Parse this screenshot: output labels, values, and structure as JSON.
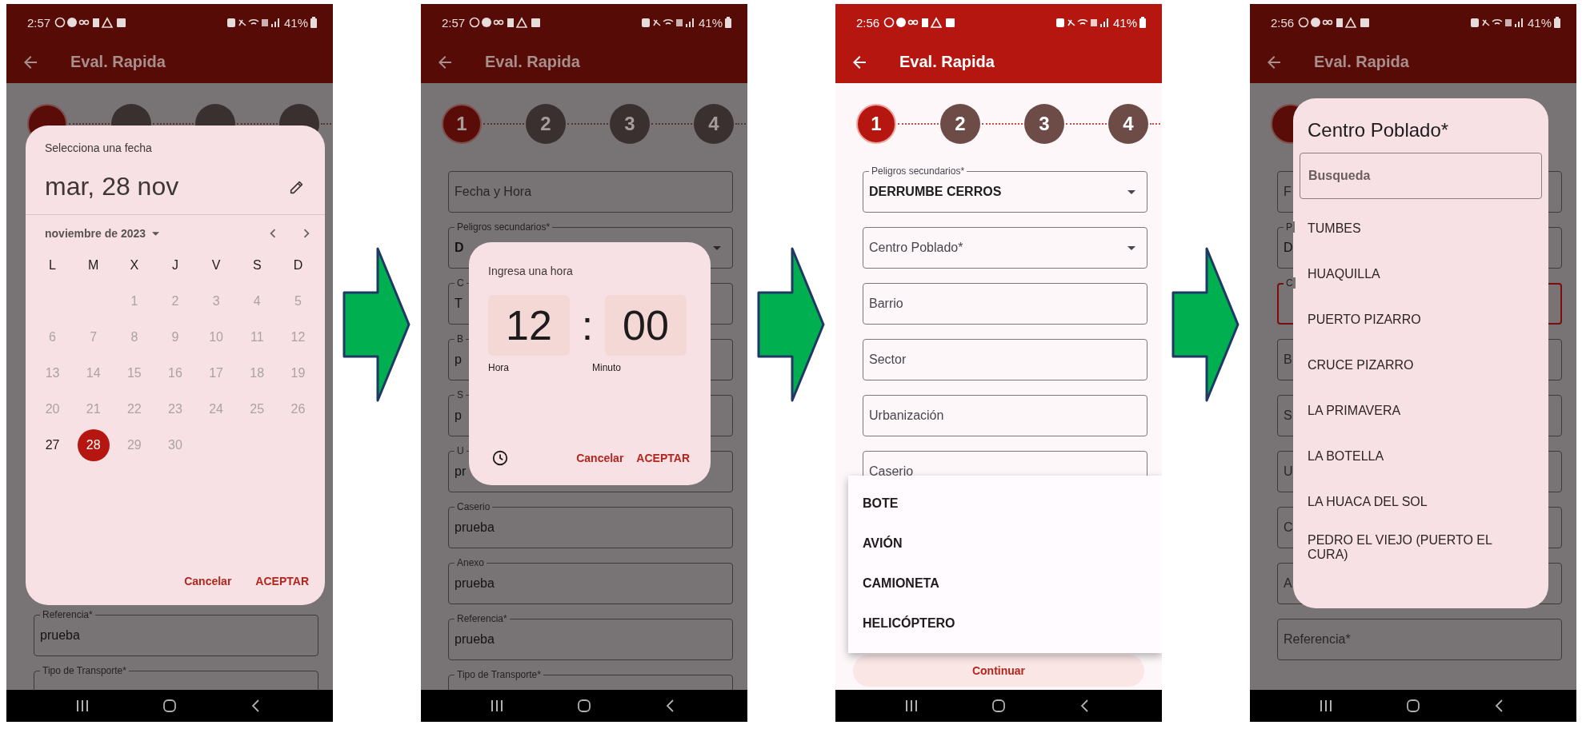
{
  "screens": [
    {
      "status": {
        "time": "2:57",
        "battery": "41%"
      },
      "app_bar": {
        "title": "Eval. Rapida"
      },
      "dimmed": true,
      "steps": [
        {
          "selected": true
        },
        {
          "selected": false
        },
        {
          "selected": false
        },
        {
          "selected": false
        }
      ],
      "fields": [
        {
          "kind": "text",
          "label": "Referencia*",
          "value": "prueba"
        },
        {
          "kind": "dropdown",
          "label": "Tipo de Transporte*"
        }
      ],
      "overlay": {
        "kind": "date_picker",
        "title": "Selecciona una fecha",
        "headline": "mar, 28 nov",
        "month": "noviembre de 2023",
        "weekdays": [
          "L",
          "M",
          "X",
          "J",
          "V",
          "S",
          "D"
        ],
        "weeks": [
          [
            {
              "label": "1",
              "disabled": true,
              "selected": false
            },
            {
              "label": "2",
              "disabled": true,
              "selected": false
            },
            {
              "label": "3",
              "disabled": true,
              "selected": false
            },
            {
              "label": "4",
              "disabled": true,
              "selected": false
            },
            {
              "label": "5",
              "disabled": true,
              "selected": false
            }
          ],
          [
            {
              "label": "6",
              "disabled": true,
              "selected": false
            },
            {
              "label": "7",
              "disabled": true,
              "selected": false
            },
            {
              "label": "8",
              "disabled": true,
              "selected": false
            },
            {
              "label": "9",
              "disabled": true,
              "selected": false
            },
            {
              "label": "10",
              "disabled": true,
              "selected": false
            },
            {
              "label": "11",
              "disabled": true,
              "selected": false
            },
            {
              "label": "12",
              "disabled": true,
              "selected": false
            }
          ],
          [
            {
              "label": "13",
              "disabled": true,
              "selected": false
            },
            {
              "label": "14",
              "disabled": true,
              "selected": false
            },
            {
              "label": "15",
              "disabled": true,
              "selected": false
            },
            {
              "label": "16",
              "disabled": true,
              "selected": false
            },
            {
              "label": "17",
              "disabled": true,
              "selected": false
            },
            {
              "label": "18",
              "disabled": true,
              "selected": false
            },
            {
              "label": "19",
              "disabled": true,
              "selected": false
            }
          ],
          [
            {
              "label": "20",
              "disabled": true,
              "selected": false
            },
            {
              "label": "21",
              "disabled": true,
              "selected": false
            },
            {
              "label": "22",
              "disabled": true,
              "selected": false
            },
            {
              "label": "23",
              "disabled": true,
              "selected": false
            },
            {
              "label": "24",
              "disabled": true,
              "selected": false
            },
            {
              "label": "25",
              "disabled": true,
              "selected": false
            },
            {
              "label": "26",
              "disabled": true,
              "selected": false
            }
          ],
          [
            {
              "label": "27",
              "disabled": false,
              "selected": false
            },
            {
              "label": "28",
              "disabled": false,
              "selected": true
            },
            {
              "label": "29",
              "disabled": true,
              "selected": false
            },
            {
              "label": "30",
              "disabled": true,
              "selected": false
            }
          ]
        ],
        "actions": [
          "Cancelar",
          "ACEPTAR"
        ]
      }
    },
    {
      "status": {
        "time": "2:57",
        "battery": "41%"
      },
      "app_bar": {
        "title": "Eval. Rapida"
      },
      "dimmed": true,
      "steps": [
        {
          "label": "1",
          "selected": true
        },
        {
          "label": "2",
          "selected": false
        },
        {
          "label": "3",
          "selected": false
        },
        {
          "label": "4",
          "selected": false
        }
      ],
      "fields": [
        {
          "kind": "text",
          "placeholder": "Fecha y Hora"
        },
        {
          "kind": "dropdown",
          "label": "Peligros secundarios*",
          "value": "D"
        },
        {
          "kind": "text",
          "label": "C",
          "value": "T"
        },
        {
          "kind": "text",
          "label": "B",
          "value": "p"
        },
        {
          "kind": "text",
          "label": "S",
          "value": "p"
        },
        {
          "kind": "text",
          "label": "U",
          "value": "pr"
        },
        {
          "kind": "text",
          "label": "Caserio",
          "value": "prueba"
        },
        {
          "kind": "text",
          "label": "Anexo",
          "value": "prueba"
        },
        {
          "kind": "text",
          "label": "Referencia*",
          "value": "prueba"
        },
        {
          "kind": "dropdown",
          "label": "Tipo de Transporte*"
        }
      ],
      "overlay": {
        "kind": "time_picker",
        "title": "Ingresa una hora",
        "hour": "12",
        "separator": ":",
        "minute": "00",
        "hour_label": "Hora",
        "minute_label": "Minuto",
        "actions": [
          "Cancelar",
          "ACEPTAR"
        ]
      }
    },
    {
      "status": {
        "time": "2:56",
        "battery": "41%"
      },
      "app_bar": {
        "title": "Eval. Rapida"
      },
      "dimmed": false,
      "steps": [
        {
          "label": "1",
          "selected": true
        },
        {
          "label": "2",
          "selected": false
        },
        {
          "label": "3",
          "selected": false
        },
        {
          "label": "4",
          "selected": false
        }
      ],
      "fields": [
        {
          "kind": "dropdown",
          "label": "Peligros secundarios*",
          "value": "DERRUMBE CERROS"
        },
        {
          "kind": "dropdown",
          "placeholder": "Centro Poblado*"
        },
        {
          "kind": "text",
          "placeholder": "Barrio"
        },
        {
          "kind": "text",
          "placeholder": "Sector"
        },
        {
          "kind": "text",
          "placeholder": "Urbanización"
        },
        {
          "kind": "text",
          "placeholder": "Caserio"
        }
      ],
      "button": "Continuar",
      "overlay": {
        "kind": "menu",
        "items": [
          "BOTE",
          "AVIÓN",
          "CAMIONETA",
          "HELICÓPTERO"
        ]
      }
    },
    {
      "status": {
        "time": "2:56",
        "battery": "41%"
      },
      "app_bar": {
        "title": "Eval. Rapida"
      },
      "dimmed": true,
      "steps": [
        {
          "selected": true
        }
      ],
      "fields": [
        {
          "kind": "text",
          "placeholder": "F",
          "focused": false
        },
        {
          "kind": "text",
          "label": "P",
          "value": "D",
          "focused": false
        },
        {
          "kind": "text",
          "label": "C",
          "focused": true
        },
        {
          "kind": "text",
          "placeholder": "B",
          "focused": false
        },
        {
          "kind": "text",
          "placeholder": "S",
          "focused": false
        },
        {
          "kind": "text",
          "placeholder": "U",
          "focused": false
        },
        {
          "kind": "text",
          "placeholder": "C",
          "focused": false
        },
        {
          "kind": "text",
          "placeholder": "A",
          "focused": false
        },
        {
          "kind": "text",
          "placeholder": "Referencia*",
          "focused": false
        }
      ],
      "overlay": {
        "kind": "search_dialog",
        "title": "Centro Poblado*",
        "search": {
          "placeholder": "Busqueda"
        },
        "items": [
          "TUMBES",
          "HUAQUILLA",
          "PUERTO PIZARRO",
          "CRUCE PIZARRO",
          "LA PRIMAVERA",
          "LA BOTELLA",
          "LA HUACA DEL SOL",
          "PEDRO EL VIEJO (PUERTO EL CURA)"
        ]
      }
    }
  ]
}
